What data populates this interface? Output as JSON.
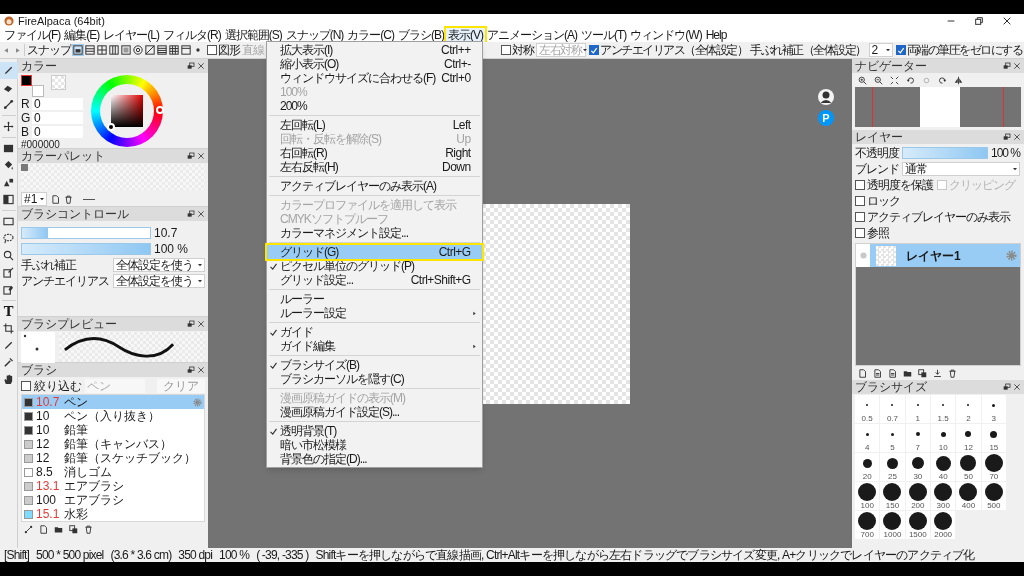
{
  "window": {
    "title": "FireAlpaca (64bit)"
  },
  "menu_bar": [
    {
      "label": "ファイル(F)",
      "selected": false,
      "annotated": false
    },
    {
      "label": "編集(E)",
      "selected": false,
      "annotated": false
    },
    {
      "label": "レイヤー(L)",
      "selected": false,
      "annotated": false
    },
    {
      "label": "フィルタ(R)",
      "selected": false,
      "annotated": false
    },
    {
      "label": "選択範囲(S)",
      "selected": false,
      "annotated": false
    },
    {
      "label": "スナップ(N)",
      "selected": false,
      "annotated": false
    },
    {
      "label": "カラー(C)",
      "selected": false,
      "annotated": false
    },
    {
      "label": "ブラシ(B)",
      "selected": false,
      "annotated": false
    },
    {
      "label": "表示(V)",
      "selected": true,
      "annotated": true
    },
    {
      "label": "アニメーション(A)",
      "selected": false,
      "annotated": false
    },
    {
      "label": "ツール(T)",
      "selected": false,
      "annotated": false
    },
    {
      "label": "ウィンドウ(W)",
      "selected": false,
      "annotated": false
    },
    {
      "label": "Help",
      "selected": false,
      "annotated": false
    }
  ],
  "view_menu": [
    {
      "kind": "item",
      "label": "拡大表示(I)",
      "shortcut": "Ctrl++",
      "checked": false,
      "disabled": false,
      "selected": false,
      "annotated": false,
      "submenu": false
    },
    {
      "kind": "item",
      "label": "縮小表示(O)",
      "shortcut": "Ctrl+-",
      "checked": false,
      "disabled": false,
      "selected": false,
      "annotated": false,
      "submenu": false
    },
    {
      "kind": "item",
      "label": "ウィンドウサイズに合わせる(F)",
      "shortcut": "Ctrl+0",
      "checked": false,
      "disabled": false,
      "selected": false,
      "annotated": false,
      "submenu": false
    },
    {
      "kind": "item",
      "label": "100%",
      "checked": false,
      "disabled": true,
      "selected": false,
      "annotated": false,
      "submenu": false
    },
    {
      "kind": "item",
      "label": "200%",
      "checked": false,
      "disabled": false,
      "selected": false,
      "annotated": false,
      "submenu": false
    },
    {
      "kind": "separator"
    },
    {
      "kind": "item",
      "label": "左回転(L)",
      "shortcut": "Left",
      "checked": false,
      "disabled": false,
      "selected": false,
      "annotated": false,
      "submenu": false
    },
    {
      "kind": "item",
      "label": "回転・反転を解除(S)",
      "shortcut": "Up",
      "checked": false,
      "disabled": true,
      "selected": false,
      "annotated": false,
      "submenu": false
    },
    {
      "kind": "item",
      "label": "右回転(R)",
      "shortcut": "Right",
      "checked": false,
      "disabled": false,
      "selected": false,
      "annotated": false,
      "submenu": false
    },
    {
      "kind": "item",
      "label": "左右反転(H)",
      "shortcut": "Down",
      "checked": false,
      "disabled": false,
      "selected": false,
      "annotated": false,
      "submenu": false
    },
    {
      "kind": "separator"
    },
    {
      "kind": "item",
      "label": "アクティブレイヤーのみ表示(A)",
      "checked": false,
      "disabled": false,
      "selected": false,
      "annotated": false,
      "submenu": false
    },
    {
      "kind": "separator"
    },
    {
      "kind": "item",
      "label": "カラープロファイルを適用して表示",
      "checked": false,
      "disabled": true,
      "selected": false,
      "annotated": false,
      "submenu": false
    },
    {
      "kind": "item",
      "label": "CMYKソフトプルーフ",
      "checked": false,
      "disabled": true,
      "selected": false,
      "annotated": false,
      "submenu": false
    },
    {
      "kind": "item",
      "label": "カラーマネジメント設定...",
      "checked": false,
      "disabled": false,
      "selected": false,
      "annotated": false,
      "submenu": false
    },
    {
      "kind": "separator"
    },
    {
      "kind": "item",
      "label": "グリッド(G)",
      "shortcut": "Ctrl+G",
      "checked": false,
      "disabled": false,
      "selected": true,
      "annotated": true,
      "submenu": false
    },
    {
      "kind": "item",
      "label": "ピクセル単位のグリッド(P)",
      "checked": true,
      "disabled": false,
      "selected": false,
      "annotated": false,
      "submenu": false
    },
    {
      "kind": "item",
      "label": "グリッド設定...",
      "shortcut": "Ctrl+Shift+G",
      "checked": false,
      "disabled": false,
      "selected": false,
      "annotated": false,
      "submenu": false
    },
    {
      "kind": "separator"
    },
    {
      "kind": "item",
      "label": "ルーラー",
      "checked": false,
      "disabled": false,
      "selected": false,
      "annotated": false,
      "submenu": false
    },
    {
      "kind": "item",
      "label": "ルーラー設定",
      "checked": false,
      "disabled": false,
      "selected": false,
      "annotated": false,
      "submenu": true
    },
    {
      "kind": "separator"
    },
    {
      "kind": "item",
      "label": "ガイド",
      "checked": true,
      "disabled": false,
      "selected": false,
      "annotated": false,
      "submenu": false
    },
    {
      "kind": "item",
      "label": "ガイド編集",
      "checked": false,
      "disabled": false,
      "selected": false,
      "annotated": false,
      "submenu": true
    },
    {
      "kind": "separator"
    },
    {
      "kind": "item",
      "label": "ブラシサイズ(B)",
      "checked": true,
      "disabled": false,
      "selected": false,
      "annotated": false,
      "submenu": false
    },
    {
      "kind": "item",
      "label": "ブラシカーソルを隠す(C)",
      "checked": false,
      "disabled": false,
      "selected": false,
      "annotated": false,
      "submenu": false
    },
    {
      "kind": "separator"
    },
    {
      "kind": "item",
      "label": "漫画原稿ガイドの表示(M)",
      "checked": false,
      "disabled": true,
      "selected": false,
      "annotated": false,
      "submenu": false
    },
    {
      "kind": "item",
      "label": "漫画原稿ガイド設定(S)...",
      "checked": false,
      "disabled": false,
      "selected": false,
      "annotated": false,
      "submenu": false
    },
    {
      "kind": "separator"
    },
    {
      "kind": "item",
      "label": "透明背景(T)",
      "checked": true,
      "disabled": false,
      "selected": false,
      "annotated": false,
      "submenu": false
    },
    {
      "kind": "item",
      "label": "暗い市松模様",
      "checked": false,
      "disabled": false,
      "selected": false,
      "annotated": false,
      "submenu": false
    },
    {
      "kind": "item",
      "label": "背景色の指定(D)...",
      "checked": false,
      "disabled": false,
      "selected": false,
      "annotated": false,
      "submenu": false
    }
  ],
  "toolbar": {
    "snap_label": "スナップ",
    "snap_modes": [
      {
        "selected": true
      },
      {
        "selected": false
      },
      {
        "selected": false
      },
      {
        "selected": false
      },
      {
        "selected": false
      },
      {
        "selected": false
      },
      {
        "selected": false
      },
      {
        "selected": false
      },
      {
        "selected": false
      },
      {
        "selected": false
      },
      {
        "selected": false
      }
    ],
    "shape": {
      "label": "図形",
      "checked": false
    },
    "shape_type": {
      "value": "直線",
      "disabled": true
    },
    "symmetry": {
      "label": "対称",
      "checked": false
    },
    "symmetry_type": {
      "value": "左右対称",
      "disabled": true
    },
    "antialias": {
      "label": "アンチエイリアス（全体設定）",
      "checked": true
    },
    "stabilizer": {
      "label": "手ぶれ補正（全体設定）",
      "value": "2"
    },
    "pressure": {
      "label": "両端の筆圧をゼロにする",
      "checked": true
    }
  },
  "tools": [
    {
      "kind": "pen",
      "selected": true
    },
    {
      "kind": "eraser",
      "selected": false
    },
    {
      "kind": "dot-pen",
      "selected": false
    },
    {
      "kind": "separator"
    },
    {
      "kind": "move",
      "selected": false
    },
    {
      "kind": "separator"
    },
    {
      "kind": "fill-rect",
      "selected": false
    },
    {
      "kind": "bucket",
      "selected": false
    },
    {
      "kind": "shape-fill",
      "selected": false
    },
    {
      "kind": "gradient",
      "selected": false
    },
    {
      "kind": "separator"
    },
    {
      "kind": "rect-select",
      "selected": false
    },
    {
      "kind": "lasso",
      "selected": false
    },
    {
      "kind": "magic-wand",
      "selected": false
    },
    {
      "kind": "select-pen",
      "selected": false
    },
    {
      "kind": "select-eraser",
      "selected": false
    },
    {
      "kind": "separator"
    },
    {
      "kind": "text",
      "label": "T",
      "selected": false
    },
    {
      "kind": "transform",
      "selected": false
    },
    {
      "kind": "eyedropper",
      "selected": false
    },
    {
      "kind": "dropper",
      "selected": false
    },
    {
      "kind": "hand",
      "selected": false
    }
  ],
  "color_panel": {
    "title": "カラー",
    "foreground": {
      "color": "#000000"
    },
    "background": {
      "color": "#ffffff"
    },
    "channels": [
      {
        "label": "R",
        "value": "0"
      },
      {
        "label": "G",
        "value": "0"
      },
      {
        "label": "B",
        "value": "0"
      }
    ],
    "hex": "#000000"
  },
  "palette_panel": {
    "title": "カラーパレット",
    "swatches": [
      {
        "color": "#7a7a7a"
      }
    ],
    "palette": "#1"
  },
  "brush_control": {
    "title": "ブラシコントロール",
    "size": {
      "level": 0.2,
      "reading": "10.7"
    },
    "opacity": {
      "level": 1,
      "reading": "100 %"
    },
    "settings": [
      {
        "label": "手ぶれ補正",
        "value": "全体設定を使う"
      },
      {
        "label": "アンチエイリアス",
        "value": "全体設定を使う"
      }
    ]
  },
  "brush_preview": {
    "title": "ブラシプレビュー"
  },
  "brush_panel": {
    "title": "ブラシ",
    "filter": {
      "label": "絞り込む",
      "checked": false
    },
    "filter_field": {
      "placeholder": "ペン"
    },
    "clear_button": "クリア",
    "brushes": [
      {
        "size": "10.7",
        "name": "ペン",
        "color": "#333333",
        "modified": true,
        "selected": true
      },
      {
        "size": "10",
        "name": "ペン（入り抜き）",
        "color": "#333333",
        "modified": false,
        "selected": false
      },
      {
        "size": "10",
        "name": "鉛筆",
        "color": "#333333",
        "modified": false,
        "selected": false
      },
      {
        "size": "12",
        "name": "鉛筆（キャンバス）",
        "color": "#cccccc",
        "modified": false,
        "selected": false
      },
      {
        "size": "12",
        "name": "鉛筆（スケッチブック）",
        "color": "#cccccc",
        "modified": false,
        "selected": false
      },
      {
        "size": "8.5",
        "name": "消しゴム",
        "color": "#ffffff",
        "modified": false,
        "selected": false
      },
      {
        "size": "13.1",
        "name": "エアブラシ",
        "color": "#cccccc",
        "modified": true,
        "selected": false
      },
      {
        "size": "100",
        "name": "エアブラシ",
        "color": "#cccccc",
        "modified": false,
        "selected": false
      },
      {
        "size": "15.1",
        "name": "水彩",
        "color": "#80dcff",
        "modified": true,
        "selected": false
      }
    ]
  },
  "canvas": {
    "badge": "P"
  },
  "navigator": {
    "title": "ナビゲーター"
  },
  "layer_panel": {
    "title": "レイヤー",
    "opacity": {
      "label": "不透明度",
      "level": 1,
      "reading": "100 %"
    },
    "blend": {
      "label": "ブレンド",
      "value": "通常"
    },
    "options": [
      {
        "label": "透明度を保護",
        "checked": false,
        "disabled": false
      },
      {
        "label": "クリッピング",
        "checked": false,
        "disabled": true
      },
      {
        "label": "ロック",
        "checked": false,
        "disabled": false
      },
      {
        "label": "アクティブレイヤーのみ表示",
        "checked": false,
        "disabled": false
      },
      {
        "label": "参照",
        "checked": false,
        "disabled": false
      }
    ],
    "layers": [
      {
        "name": "レイヤー1",
        "selected": true,
        "visible": true
      }
    ]
  },
  "brush_size_panel": {
    "title": "ブラシサイズ",
    "sizes": [
      "0.5",
      "0.7",
      "1",
      "1.5",
      "2",
      "3",
      "4",
      "5",
      "7",
      "10",
      "12",
      "15",
      "20",
      "25",
      "30",
      "40",
      "50",
      "70",
      "100",
      "150",
      "200",
      "300",
      "400",
      "500",
      "700",
      "1000",
      "1500",
      "2000"
    ]
  },
  "status_bar": [
    "[Shift]",
    "500 * 500 pixel",
    "(3.6 * 3.6 cm)",
    "350 dpi",
    "100 %",
    "( -39, -335 )",
    "Shiftキーを押しながらで直線描画, Ctrl+Altキーを押しながら左右ドラッグでブラシサイズ変更, A+クリックでレイヤーのアクティブ化"
  ]
}
